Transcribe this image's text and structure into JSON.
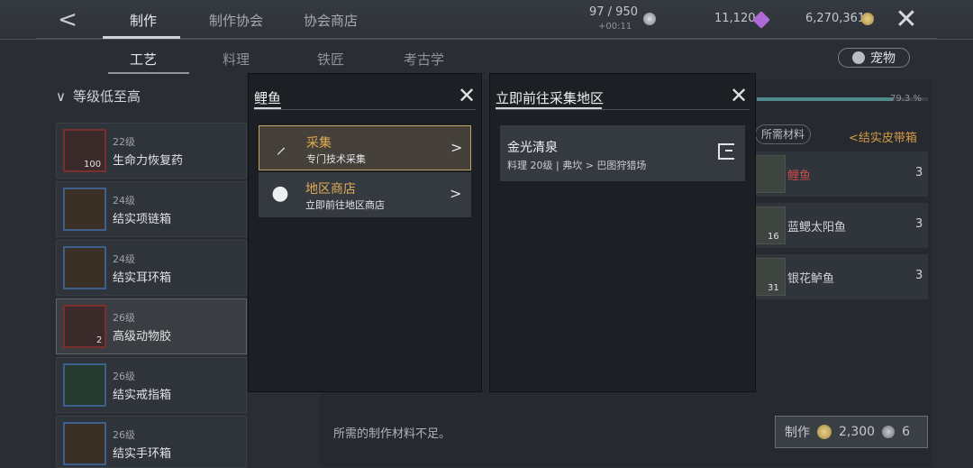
{
  "header": {
    "back_glyph": "<",
    "tabs": [
      {
        "label": "制作",
        "active": true
      },
      {
        "label": "制作协会",
        "active": false
      },
      {
        "label": "协会商店",
        "active": false
      }
    ],
    "energy": "97 / 950",
    "energy_timer": "+00:11",
    "gems": "11,120",
    "gold": "6,270,361",
    "close_glyph": "✕"
  },
  "subtabs": [
    {
      "label": "工艺",
      "active": true
    },
    {
      "label": "料理",
      "active": false
    },
    {
      "label": "铁匠",
      "active": false
    },
    {
      "label": "考古学",
      "active": false
    }
  ],
  "pet_button": "宠物",
  "sort_label": "等级低至高",
  "recipes": [
    {
      "level": "22级",
      "name": "生命力恢复药",
      "count": "100",
      "active": false
    },
    {
      "level": "24级",
      "name": "结实项链箱",
      "count": "",
      "active": false
    },
    {
      "level": "24级",
      "name": "结实耳环箱",
      "count": "",
      "active": false
    },
    {
      "level": "26级",
      "name": "高级动物胶",
      "count": "2",
      "active": true
    },
    {
      "level": "26级",
      "name": "结实戒指箱",
      "count": "",
      "active": false
    },
    {
      "level": "26级",
      "name": "结实手环箱",
      "count": "",
      "active": false
    }
  ],
  "detail": {
    "progress_pct": "79.3 %",
    "progress_value": 79.3,
    "required_materials_btn": "所需材料",
    "belt_box_link": "结实皮带箱",
    "materials": [
      {
        "name": "鲤鱼",
        "qty": "3",
        "owned": "",
        "insufficient": true
      },
      {
        "name": "蓝鳃太阳鱼",
        "qty": "3",
        "owned": "16",
        "insufficient": false
      },
      {
        "name": "银花鲈鱼",
        "qty": "3",
        "owned": "31",
        "insufficient": false
      }
    ],
    "insufficient_msg": "所需的制作材料不足。",
    "craft_label": "制作",
    "craft_cost_gold": "2,300",
    "craft_cost_other": "6"
  },
  "popup_source": {
    "title": "鲤鱼",
    "options": [
      {
        "title": "采集",
        "subtitle": "专门技术采集",
        "icon": "pickaxe-icon",
        "active": true
      },
      {
        "title": "地区商店",
        "subtitle": "立即前往地区商店",
        "icon": "money-bag-icon",
        "active": false
      }
    ]
  },
  "popup_location": {
    "title": "立即前往采集地区",
    "location_name": "金光清泉",
    "location_detail": "料理 20级 | 弗坎 > 巴图狩猎场"
  },
  "colors": {
    "accent_gold": "#e1ab55",
    "warning_red": "#c54a4a",
    "link_orange": "#d59a43"
  }
}
